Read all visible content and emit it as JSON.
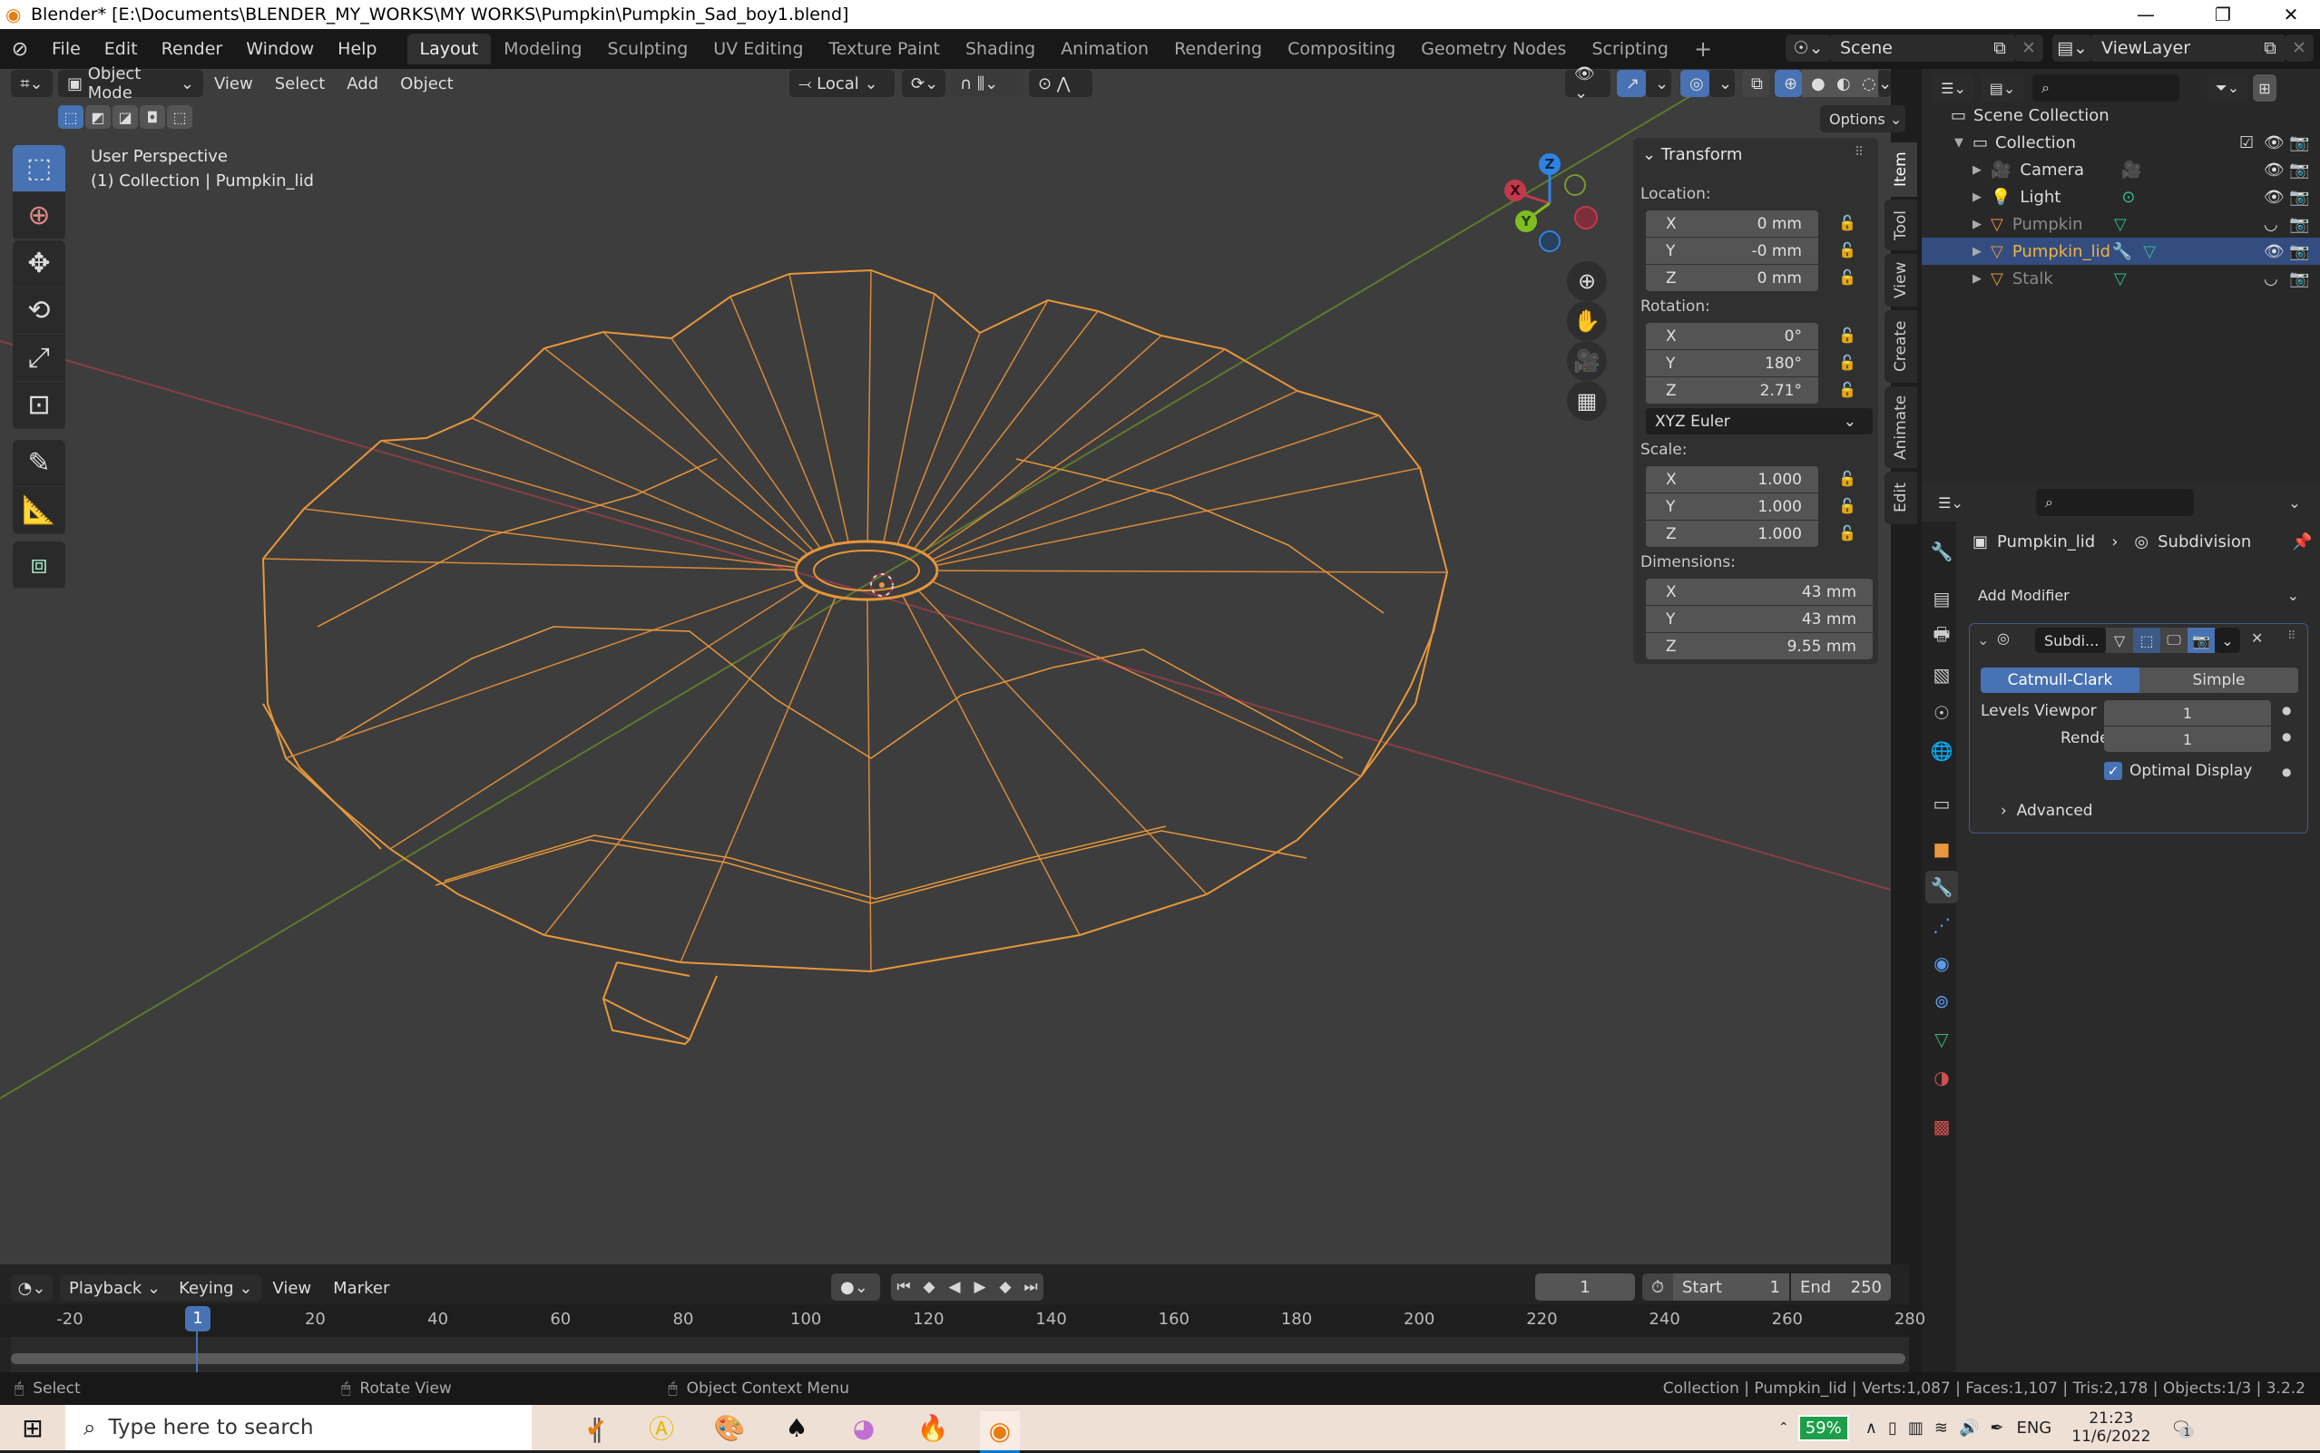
{
  "window": {
    "title": "Blender* [E:\\Documents\\BLENDER_MY_WORKS\\MY WORKS\\Pumpkin\\Pumpkin_Sad_boy1.blend]",
    "controls": [
      "minimize",
      "maximize",
      "close"
    ]
  },
  "menu": [
    "File",
    "Edit",
    "Render",
    "Window",
    "Help"
  ],
  "workspaces": [
    "Layout",
    "Modeling",
    "Sculpting",
    "UV Editing",
    "Texture Paint",
    "Shading",
    "Animation",
    "Rendering",
    "Compositing",
    "Geometry Nodes",
    "Scripting"
  ],
  "active_workspace": "Layout",
  "add_workspace": "+",
  "scene": {
    "label": "Scene",
    "view_layer": "ViewLayer"
  },
  "viewport_header": {
    "mode": "Object Mode",
    "menus": [
      "View",
      "Select",
      "Add",
      "Object"
    ],
    "transform_orientation": "Local",
    "options": "Options"
  },
  "viewport": {
    "perspective": "User Perspective",
    "context": "(1) Collection | Pumpkin_lid",
    "gizmo_axes": [
      "X",
      "Y",
      "Z"
    ],
    "colors": {
      "background": "#3d3d3d",
      "wire_selected": "#f0a030",
      "x_axis": "#a8434f",
      "y_axis": "#6b8e23",
      "z_axis": "#2f84e3"
    }
  },
  "n_panel": {
    "tabs": [
      "Item",
      "Tool",
      "View",
      "Create",
      "Animate",
      "Edit"
    ],
    "active_tab": "Item",
    "section": "Transform",
    "location": {
      "label": "Location:",
      "x": "0 mm",
      "y": "-0 mm",
      "z": "0 mm"
    },
    "rotation": {
      "label": "Rotation:",
      "x": "0°",
      "y": "180°",
      "z": "2.71°"
    },
    "rotation_mode": "XYZ Euler",
    "scale": {
      "label": "Scale:",
      "x": "1.000",
      "y": "1.000",
      "z": "1.000"
    },
    "dimensions": {
      "label": "Dimensions:",
      "x": "43 mm",
      "y": "43 mm",
      "z": "9.55 mm"
    },
    "axis_labels": [
      "X",
      "Y",
      "Z"
    ]
  },
  "outliner": {
    "root": "Scene Collection",
    "collection": "Collection",
    "items": [
      {
        "name": "Camera",
        "visible": true,
        "selected": false
      },
      {
        "name": "Light",
        "visible": true,
        "selected": false
      },
      {
        "name": "Pumpkin",
        "visible": false,
        "selected": false
      },
      {
        "name": "Pumpkin_lid",
        "visible": true,
        "selected": true
      },
      {
        "name": "Stalk",
        "visible": false,
        "selected": false
      }
    ]
  },
  "properties": {
    "breadcrumb_object": "Pumpkin_lid",
    "breadcrumb_modifier": "Subdivision",
    "add_modifier": "Add Modifier",
    "modifier_name": "Subdi...",
    "type_options": [
      "Catmull-Clark",
      "Simple"
    ],
    "active_type": "Catmull-Clark",
    "levels_viewport_label": "Levels Viewpor",
    "levels_viewport": "1",
    "render_label": "Render",
    "render": "1",
    "optimal_display_label": "Optimal Display",
    "optimal_display": true,
    "advanced": "Advanced"
  },
  "timeline": {
    "menus": [
      "Playback",
      "Keying",
      "View",
      "Marker"
    ],
    "current_frame": "1",
    "start_label": "Start",
    "start": "1",
    "end_label": "End",
    "end": "250",
    "ruler_ticks": [
      "-20",
      "20",
      "40",
      "60",
      "80",
      "100",
      "120",
      "140",
      "160",
      "180",
      "200",
      "220",
      "240",
      "260",
      "280"
    ],
    "playhead": "1"
  },
  "statusbar": {
    "hints": [
      "Select",
      "Rotate View",
      "Object Context Menu"
    ],
    "stats": "Collection | Pumpkin_lid | Verts:1,087 | Faces:1,107 | Tris:2,178 | Objects:1/3 | 3.2.2"
  },
  "taskbar": {
    "search_placeholder": "Type here to search",
    "battery": "59%",
    "language": "ENG",
    "time": "21:23",
    "date": "11/6/2022",
    "notifications": "1"
  }
}
